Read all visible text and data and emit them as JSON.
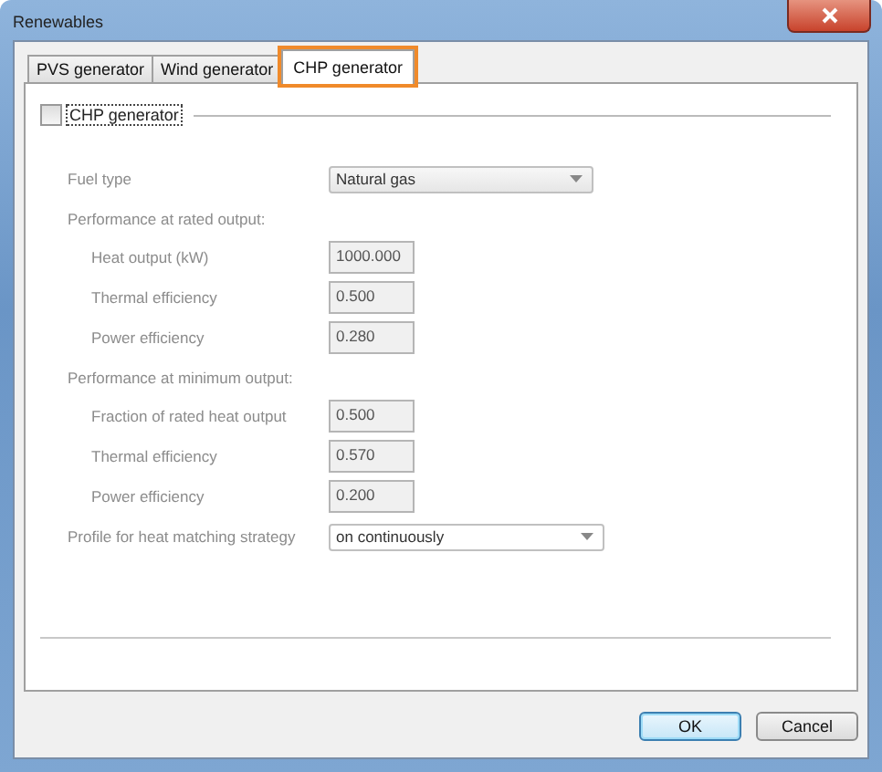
{
  "window": {
    "title": "Renewables"
  },
  "tabs": [
    {
      "label": "PVS generator",
      "selected": false
    },
    {
      "label": "Wind generator",
      "selected": false
    },
    {
      "label": "CHP generator",
      "selected": true
    }
  ],
  "group": {
    "label": "CHP generator",
    "checked": false
  },
  "rows": [
    {
      "kind": "select",
      "label": "Fuel type",
      "value": "Natural gas",
      "disabled": true
    },
    {
      "kind": "heading",
      "label": "Performance at rated output:",
      "disabled": true
    },
    {
      "kind": "number",
      "label": "Heat output (kW)",
      "value": "1000.000",
      "disabled": true
    },
    {
      "kind": "number",
      "label": "Thermal efficiency",
      "value": "0.500",
      "disabled": true
    },
    {
      "kind": "number",
      "label": "Power efficiency",
      "value": "0.280",
      "disabled": true
    },
    {
      "kind": "heading",
      "label": "Performance at minimum output:",
      "disabled": true
    },
    {
      "kind": "number",
      "label": "Fraction of rated heat output",
      "value": "0.500",
      "disabled": true
    },
    {
      "kind": "number",
      "label": "Thermal efficiency",
      "value": "0.570",
      "disabled": true
    },
    {
      "kind": "number",
      "label": "Power efficiency",
      "value": "0.200",
      "disabled": true
    },
    {
      "kind": "wideselect",
      "label": "Profile for heat matching strategy",
      "value": "on continuously",
      "disabled": true
    }
  ],
  "buttons": [
    {
      "label": "OK",
      "default": true
    },
    {
      "label": "Cancel",
      "default": false
    }
  ]
}
